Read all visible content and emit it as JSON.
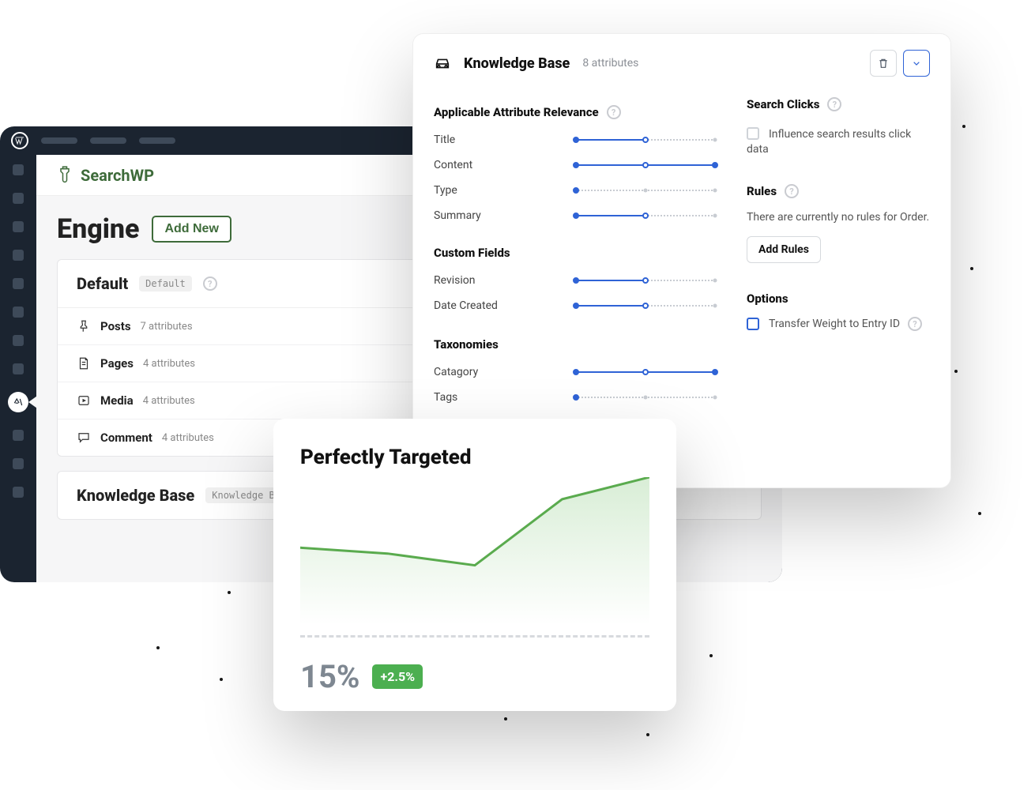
{
  "app": {
    "name": "SearchWP"
  },
  "engine": {
    "title": "Engine",
    "add_new": "Add New",
    "cards": [
      {
        "title": "Default",
        "tag": "Default",
        "items": [
          {
            "label": "Posts",
            "count": "7 attributes"
          },
          {
            "label": "Pages",
            "count": "4 attributes"
          },
          {
            "label": "Media",
            "count": "4 attributes"
          },
          {
            "label": "Comment",
            "count": "4 attributes"
          }
        ]
      },
      {
        "title": "Knowledge Base",
        "tag": "Knowledge Base"
      }
    ]
  },
  "kb": {
    "title": "Knowledge Base",
    "subtitle": "8 attributes",
    "sections": {
      "attr": "Applicable Attribute Relevance",
      "custom": "Custom Fields",
      "tax": "Taxonomies"
    },
    "attrs": [
      {
        "label": "Title",
        "fill": 50,
        "end": false
      },
      {
        "label": "Content",
        "fill": 100,
        "end": true
      },
      {
        "label": "Type",
        "fill": 0,
        "end": false
      },
      {
        "label": "Summary",
        "fill": 50,
        "end": false
      }
    ],
    "custom": [
      {
        "label": "Revision",
        "fill": 50,
        "end": false
      },
      {
        "label": "Date Created",
        "fill": 50,
        "end": false
      }
    ],
    "tax": [
      {
        "label": "Catagory",
        "fill": 100,
        "end": true
      },
      {
        "label": "Tags",
        "fill": 0,
        "end": false
      }
    ],
    "right": {
      "clicks_title": "Search Clicks",
      "clicks_label": "Influence search results click data",
      "rules_title": "Rules",
      "rules_note": "There are currently no rules for Order.",
      "rules_btn": "Add Rules",
      "options_title": "Options",
      "options_label": "Transfer Weight to Entry ID"
    }
  },
  "stats": {
    "title": "Perfectly Targeted",
    "value": "15%",
    "delta": "+2.5%"
  },
  "chart_data": {
    "type": "line",
    "x": [
      0,
      1,
      2,
      3,
      4
    ],
    "values": [
      52,
      48,
      40,
      85,
      100
    ],
    "ylim": [
      0,
      100
    ],
    "title": "Perfectly Targeted"
  }
}
